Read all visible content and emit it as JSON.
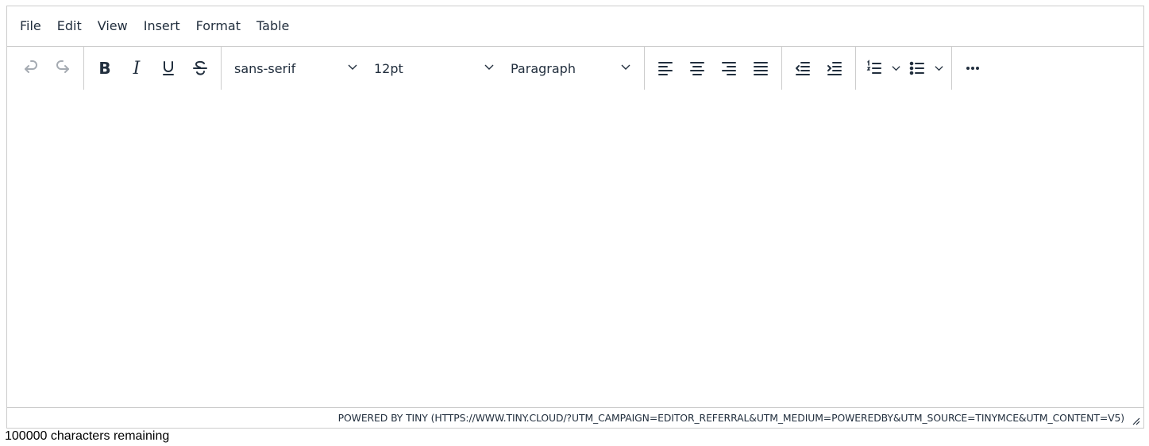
{
  "menubar": {
    "items": [
      {
        "label": "File"
      },
      {
        "label": "Edit"
      },
      {
        "label": "View"
      },
      {
        "label": "Insert"
      },
      {
        "label": "Format"
      },
      {
        "label": "Table"
      }
    ]
  },
  "toolbar": {
    "history": {
      "undo_icon": "undo-icon",
      "redo_icon": "redo-icon",
      "undo_enabled": false,
      "redo_enabled": false
    },
    "formatting": {
      "bold_glyph": "B",
      "italic_glyph": "I",
      "underline_icon": "underline-icon",
      "strikethrough_icon": "strikethrough-icon"
    },
    "font_family": {
      "value": "sans-serif"
    },
    "font_size": {
      "value": "12pt"
    },
    "block_format": {
      "value": "Paragraph"
    },
    "alignment": {
      "icons": [
        "align-left-icon",
        "align-center-icon",
        "align-right-icon",
        "align-justify-icon"
      ]
    },
    "indent": {
      "icons": [
        "outdent-icon",
        "indent-icon"
      ]
    },
    "lists": {
      "icons": [
        "numbered-list-icon",
        "bullet-list-icon"
      ]
    },
    "more": {
      "icon": "more-horizontal-icon"
    }
  },
  "statusbar": {
    "branding": "POWERED BY TINY (HTTPS://WWW.TINY.CLOUD/?UTM_CAMPAIGN=EDITOR_REFERRAL&UTM_MEDIUM=POWEREDBY&UTM_SOURCE=TINYMCE&UTM_CONTENT=V5)"
  },
  "character_counter": "100000 characters remaining",
  "colors": {
    "text": "#222f3e",
    "disabled": "#a5abb2",
    "border": "#cccccc"
  }
}
